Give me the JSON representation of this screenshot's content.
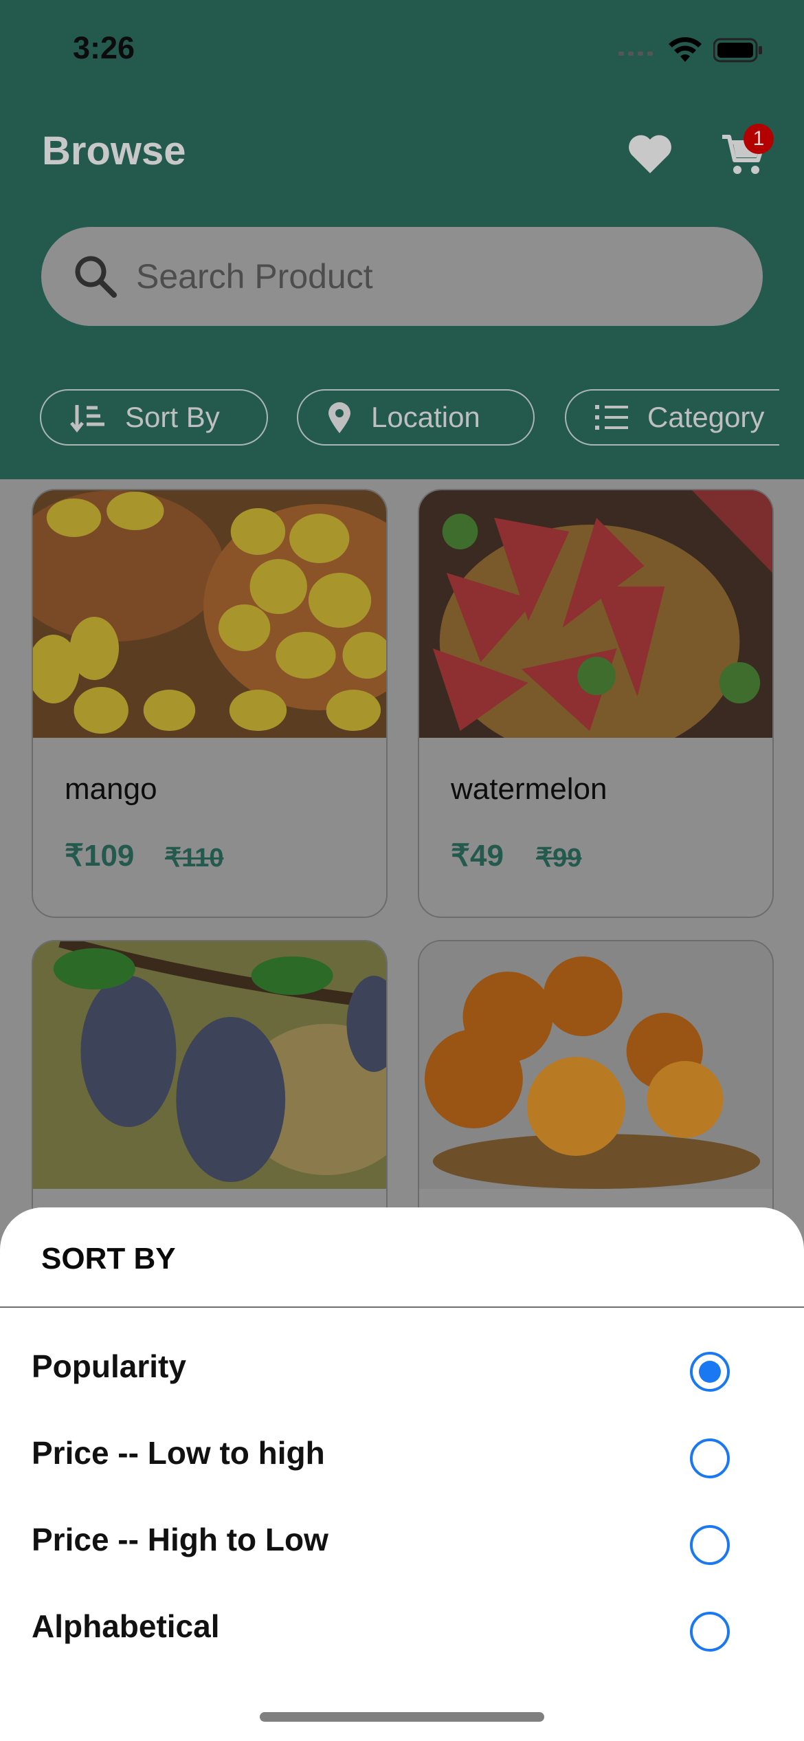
{
  "status_bar": {
    "time": "3:26"
  },
  "header": {
    "title": "Browse",
    "cart_count": "1",
    "search": {
      "placeholder": "Search Product",
      "value": ""
    },
    "filters": [
      {
        "label": "Sort By",
        "icon": "sort-icon"
      },
      {
        "label": "Location",
        "icon": "location-pin-icon"
      },
      {
        "label": "Category",
        "icon": "list-icon"
      }
    ]
  },
  "products": [
    {
      "name": "mango",
      "price": "₹109",
      "mrp": "₹110"
    },
    {
      "name": "watermelon",
      "price": "₹49",
      "mrp": "₹99"
    },
    {
      "name": "",
      "price": "",
      "mrp": ""
    },
    {
      "name": "",
      "price": "",
      "mrp": ""
    }
  ],
  "sort_sheet": {
    "title": "SORT BY",
    "selected": "Popularity",
    "options": [
      {
        "label": "Popularity",
        "selected": true
      },
      {
        "label": "Price -- Low to high",
        "selected": false
      },
      {
        "label": "Price -- High to Low",
        "selected": false
      },
      {
        "label": "Alphabetical",
        "selected": false
      }
    ]
  },
  "colors": {
    "header_bg": "#245a4e",
    "accent_blue": "#1a78f2",
    "price_green": "#245a4e",
    "badge_red": "#b30000"
  }
}
